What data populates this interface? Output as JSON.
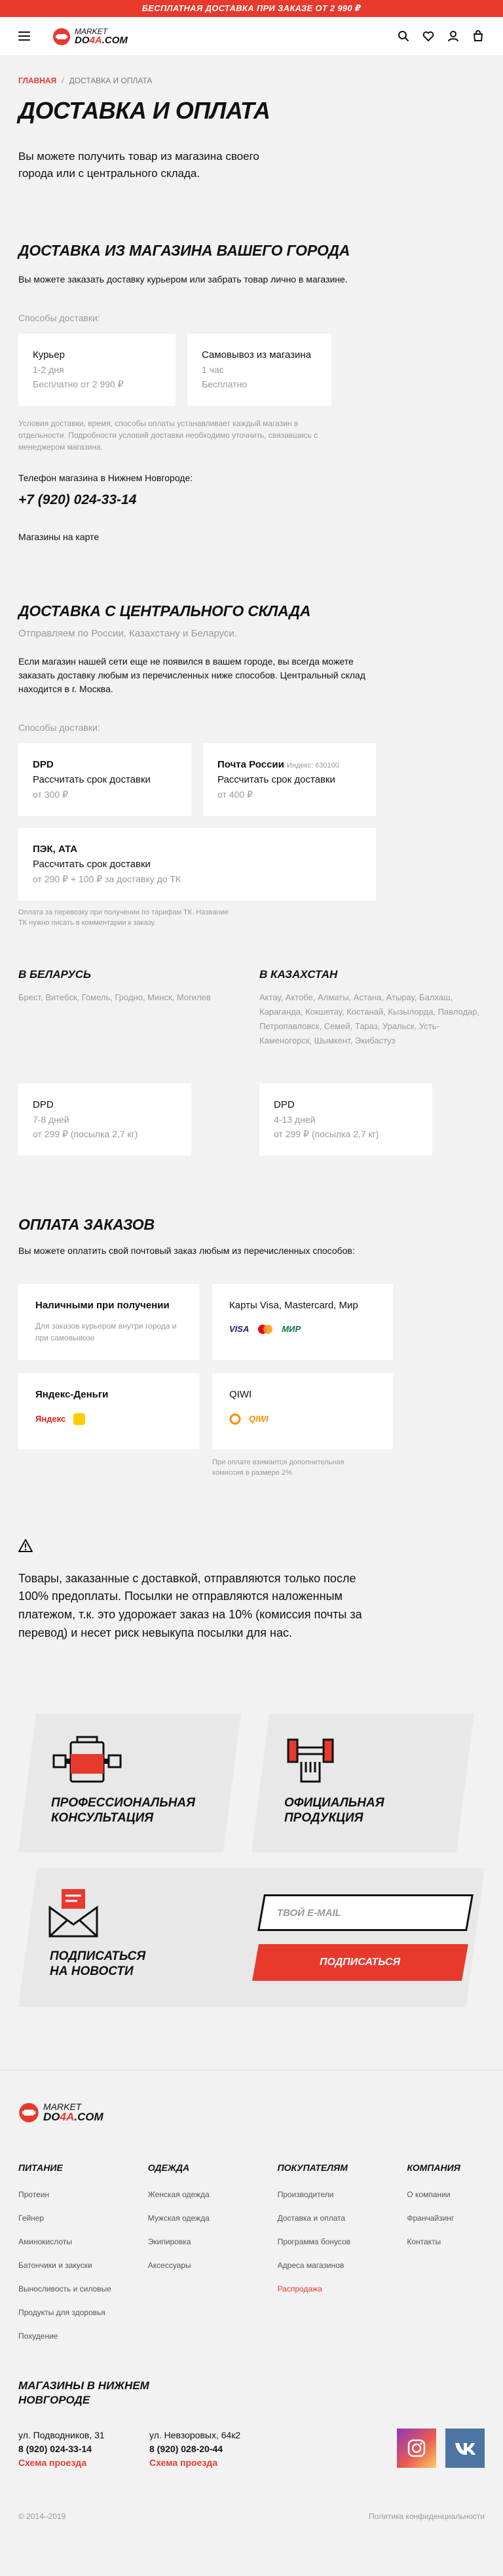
{
  "promo_bar": "БЕСПЛАТНАЯ ДОСТАВКА ПРИ ЗАКАЗЕ ОТ 2 990 ₽",
  "logo": {
    "line1": "MARKET",
    "line2a": "DO",
    "line2b": "4A",
    "line2c": ".COM"
  },
  "breadcrumb": {
    "home": "Главная",
    "sep": "/",
    "current": "Доставка и оплата"
  },
  "page_title": "Доставка и оплата",
  "lead": "Вы можете получить товар из магазина своего города или с центрального склада.",
  "city_section": {
    "title": "Доставка из магазина вашего города",
    "text": "Вы можете заказать доставку курьером или забрать товар лично в магазине.",
    "methods_label": "Способы доставки:",
    "methods": [
      {
        "name": "Курьер",
        "time": "1-2 дня",
        "price": "Бесплатно от 2 990 ₽"
      },
      {
        "name": "Самовывоз из магазина",
        "time": "1 час",
        "price": "Бесплатно"
      }
    ],
    "note": "Условия доставки, время, способы оплаты устанавливает каждый магазин в отдельности. Подробности условий доставки необходимо уточнить, связавшись с менеджером магазина.",
    "phone_label": "Телефон магазина в Нижнем Новгороде:",
    "phone": "+7 (920) 024-33-14",
    "map_link": "Магазины на карте"
  },
  "central_section": {
    "title": "Доставка с центрального склада",
    "subtitle": "Отправляем по России, Казахстану и Беларуси.",
    "text": "Если магазин нашей сети еще не появился в вашем городе, вы всегда можете заказать доставку любым из перечисленных ниже способов. Центральный склад находится в г. Москва.",
    "methods_label": "Способы доставки:",
    "methods": [
      {
        "name": "DPD",
        "index": "",
        "line": "Рассчитать срок доставки",
        "price": "от 300 ₽"
      },
      {
        "name": "Почта России",
        "index": "Индекс: 630100",
        "line": "Рассчитать срок доставки",
        "price": "от 400 ₽"
      },
      {
        "name": "ПЭК, АТА",
        "index": "",
        "line": "Рассчитать срок доставки",
        "price": "от 290 ₽ + 100 ₽ за доставку до ТК"
      }
    ],
    "tk_note": "Оплата за перевозку при получении по тарифам ТК. Название ТК нужно писать в комментарии к заказу.",
    "belarus": {
      "title": "В Беларусь",
      "cities": "Брест, Витебск, Гомель, Гродно, Минск, Могилев",
      "method": "DPD",
      "time": "7-8 дней",
      "price": "от 299 ₽ (посылка 2,7 кг)"
    },
    "kazakhstan": {
      "title": "В Казахстан",
      "cities": "Актау, Актобе, Алматы, Астана, Атырау, Балхаш, Караганда, Кокшетау, Костанай, Кызылорда, Павлодар, Петропавловск, Семей, Тараз, Уральск, Усть-Каменогорск, Шымкент, Экибастуз",
      "method": "DPD",
      "time": "4-13 дней",
      "price": "от 299 ₽ (посылка 2,7 кг)"
    }
  },
  "payment_section": {
    "title": "Оплата заказов",
    "text": "Вы можете оплатить свой почтовый заказ любым из перечисленных способов:",
    "methods": [
      {
        "name": "Наличными при получении",
        "desc": "Для заказов курьером внутри города и при самовывозе"
      },
      {
        "name": "Карты Visa, Mastercard, Мир",
        "visa": "VISA",
        "mir": "МИР"
      },
      {
        "name": "Яндекс-Деньги",
        "brand": "Яндекс"
      },
      {
        "name": "QIWI",
        "brand": "QIWI"
      }
    ],
    "qiwi_note": "При оплате взимается дополнительная комиссия в размере 2%"
  },
  "warning": "Товары, заказанные с доставкой, отправляются только после 100% предоплаты. Посылки не отправляются наложенным платежом, т.к. это удорожает заказ на 10% (комиссия почты за перевод) и несет риск невыкупа посылки для нас.",
  "promo_blocks": [
    {
      "caption_1": "Профессиональная",
      "caption_2": "консультация"
    },
    {
      "caption_1": "Официальная",
      "caption_2": "продукция"
    }
  ],
  "subscribe": {
    "caption_1": "Подписаться",
    "caption_2": "на новости",
    "placeholder": "Твой e-mail",
    "button": "Подписаться"
  },
  "footer": {
    "columns": [
      {
        "title": "Питание",
        "links": [
          "Протеин",
          "Гейнер",
          "Аминокислоты",
          "Батончики и закуски",
          "Выносливость и силовые",
          "Продукты для здоровья",
          "Похудение"
        ]
      },
      {
        "title": "Одежда",
        "links": [
          "Женская одежда",
          "Мужская одежда",
          "Экипировка",
          "Аксессуары"
        ]
      },
      {
        "title": "Покупателям",
        "links": [
          "Производители",
          "Доставка и оплата",
          "Программа бонусов",
          "Адреса магазинов",
          "Распродажа"
        ]
      },
      {
        "title": "Компания",
        "links": [
          "О компании",
          "Франчайзинг",
          "Контакты"
        ]
      }
    ],
    "stores_title_1": "Магазины в Нижнем",
    "stores_title_2": "Новгороде",
    "stores": [
      {
        "address": "ул. Подводников, 31",
        "phone": "8 (920) 024-33-14",
        "scheme": "Схема проезда"
      },
      {
        "address": "ул. Невзоровых, 64к2",
        "phone": "8 (920) 028-20-44",
        "scheme": "Схема проезда"
      }
    ],
    "copyright": "© 2014–2019",
    "extra": "Политика конфиденциальности"
  },
  "colors": {
    "accent": "#e8392d",
    "bg": "#f2f2f2",
    "card": "#ffffff"
  }
}
